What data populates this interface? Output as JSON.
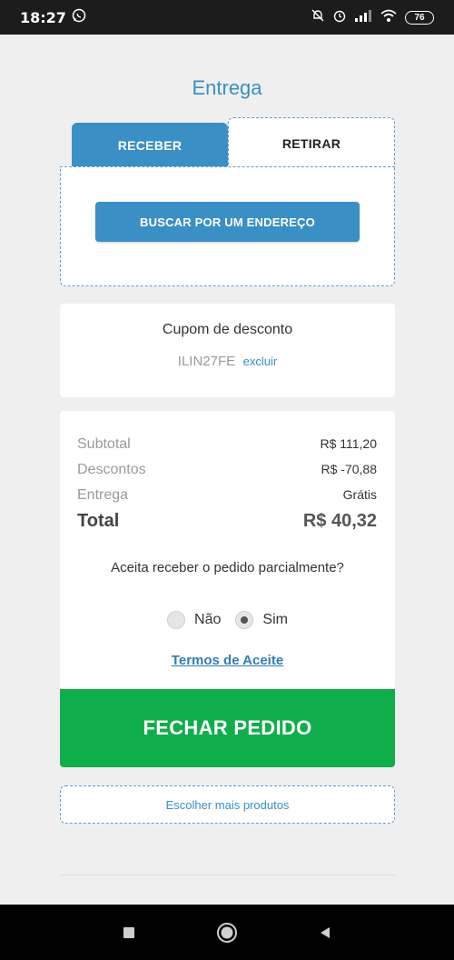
{
  "status_bar": {
    "time": "18:27",
    "battery": "76"
  },
  "page": {
    "title": "Entrega"
  },
  "tabs": {
    "receber": "RECEBER",
    "retirar": "RETIRAR"
  },
  "delivery": {
    "search_button": "BUSCAR POR UM ENDEREÇO"
  },
  "coupon": {
    "title": "Cupom de desconto",
    "code": "ILIN27FE",
    "remove_label": "excluir"
  },
  "summary": {
    "subtotal_label": "Subtotal",
    "subtotal_value": "R$ 111,20",
    "discounts_label": "Descontos",
    "discounts_value": "R$ -70,88",
    "delivery_label": "Entrega",
    "delivery_value": "Grátis",
    "total_label": "Total",
    "total_value": "R$ 40,32"
  },
  "partial": {
    "question": "Aceita receber o pedido parcialmente?",
    "option_no": "Não",
    "option_yes": "Sim",
    "selected": "Sim"
  },
  "terms_link": "Termos de Aceite",
  "checkout_button": "FECHAR PEDIDO",
  "more_products_button": "Escolher mais produtos",
  "colors": {
    "primary": "#3a8fc4",
    "checkout": "#0fae4b"
  }
}
